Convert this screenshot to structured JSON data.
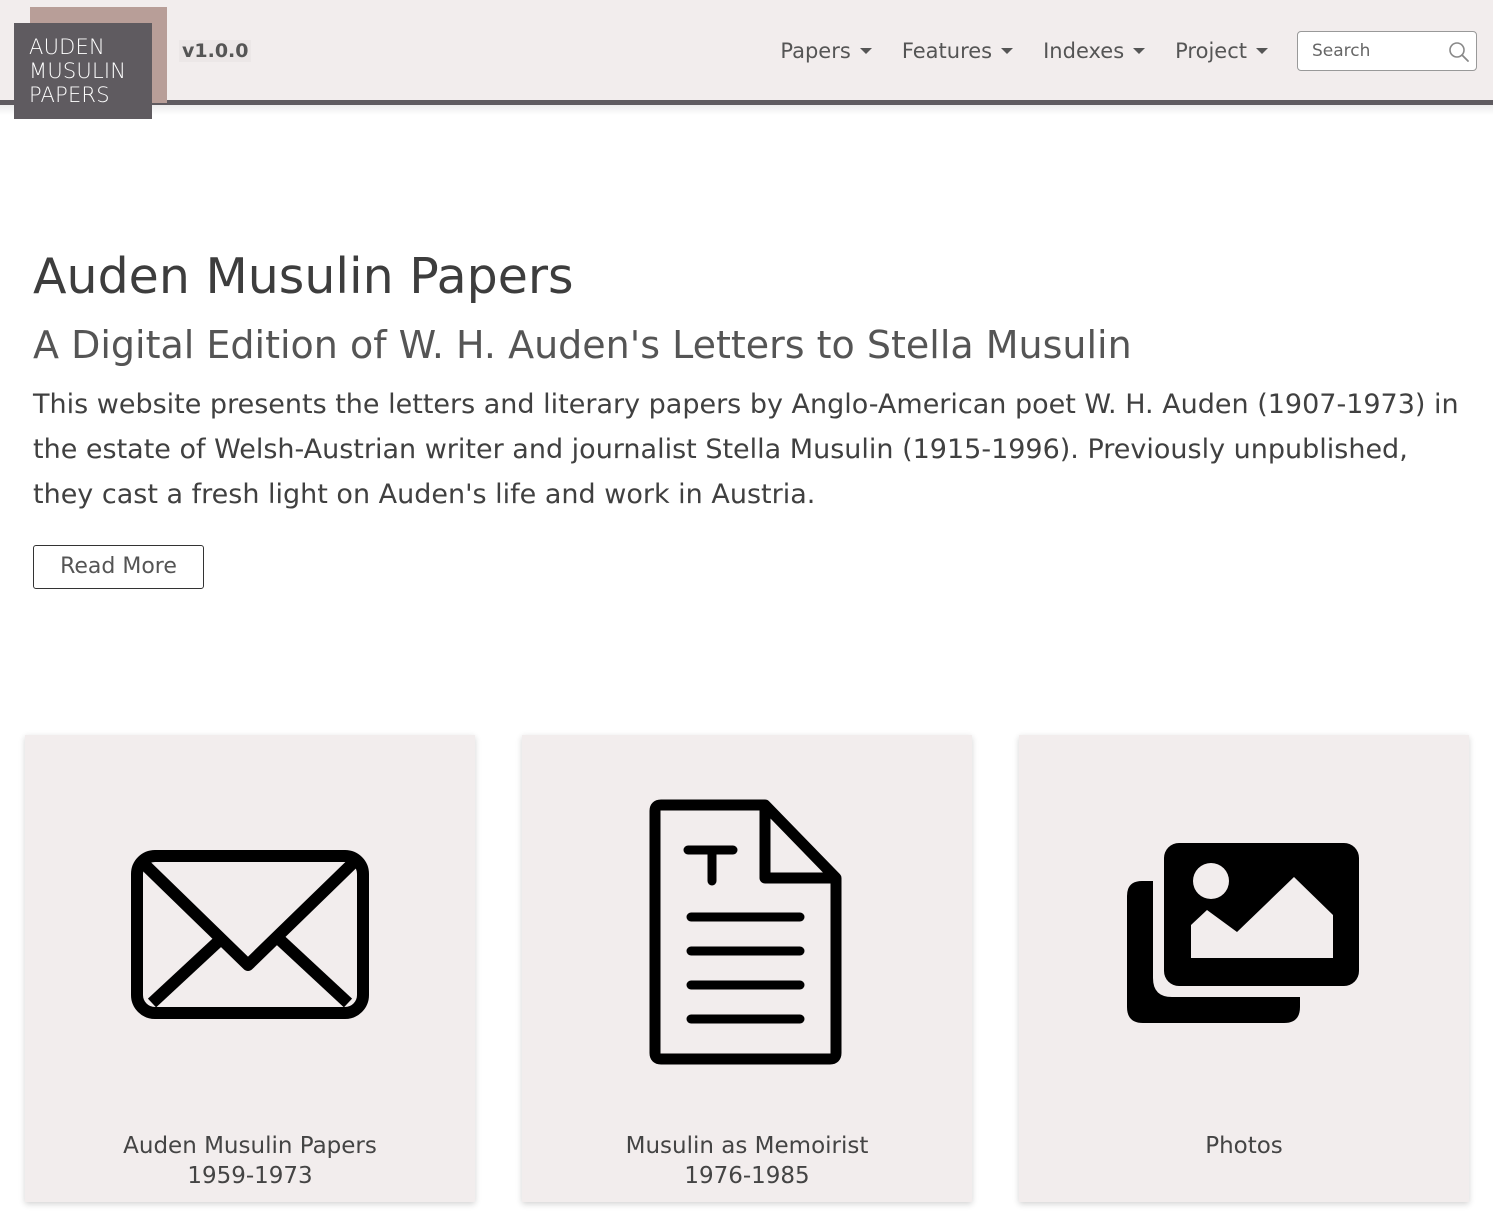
{
  "header": {
    "logo": {
      "line1": "AUDEN",
      "line2": "MUSULIN",
      "line3": "PAPERS"
    },
    "version": "v1.0.0",
    "nav": [
      {
        "label": "Papers",
        "icon": "caret-down-icon"
      },
      {
        "label": "Features",
        "icon": "caret-down-icon"
      },
      {
        "label": "Indexes",
        "icon": "caret-down-icon"
      },
      {
        "label": "Project",
        "icon": "caret-down-icon"
      }
    ],
    "search": {
      "placeholder": "Search",
      "icon": "search-icon"
    }
  },
  "hero": {
    "title": "Auden Musulin Papers",
    "subtitle": "A Digital Edition of W. H. Auden's Letters to Stella Musulin",
    "text": "This website presents the letters and literary papers by Anglo-American poet W. H. Auden (1907-1973) in the estate of Welsh-Austrian writer and journalist Stella Musulin (1915-1996). Previously unpublished, they cast a fresh light on Auden's life and work in Austria.",
    "button": "Read More"
  },
  "cards": [
    {
      "icon": "envelope-icon",
      "line1": "Auden Musulin Papers",
      "line2": "1959-1973"
    },
    {
      "icon": "text-document-icon",
      "line1": "Musulin as Memoirist",
      "line2": "1976-1985"
    },
    {
      "icon": "photos-icon",
      "line1": "Photos",
      "line2": ""
    }
  ],
  "colors": {
    "navbar_bg": "#f2eded",
    "navbar_line": "#5f5b60",
    "logo_bg": "#5f5b60",
    "logo_accent": "#b89e98",
    "card_bg": "#f2eded"
  }
}
